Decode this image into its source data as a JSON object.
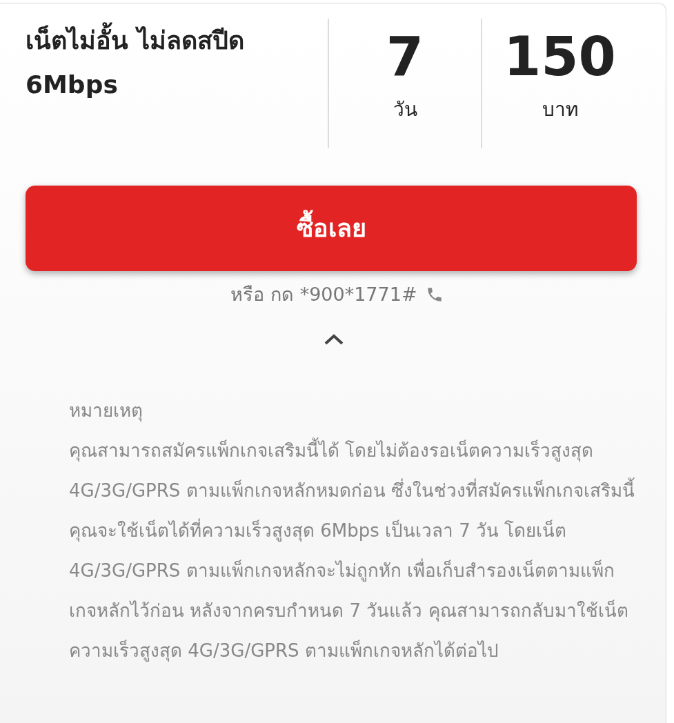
{
  "package": {
    "title": "เน็ตไม่อั้น ไม่ลดสปีด 6Mbps",
    "stats": [
      {
        "value": "7",
        "unit": "วัน"
      },
      {
        "value": "150",
        "unit": "บาท"
      }
    ]
  },
  "buy_button": "ซื้อเลย",
  "dial_hint": "หรือ กด *900*1771#",
  "expanded": true,
  "note": {
    "heading": "หมายเหตุ",
    "body": "คุณสามารถสมัครแพ็กเกจเสริมนี้ได้ โดยไม่ต้องรอเน็ตความเร็วสูงสุด 4G/3G/GPRS ตามแพ็กเกจหลักหมดก่อน ซึ่งในช่วงที่สมัครแพ็กเกจเสริมนี้ คุณจะใช้เน็ตได้ที่ความเร็วสูงสุด 6Mbps เป็นเวลา 7 วัน โดยเน็ต 4G/3G/GPRS ตามแพ็กเกจหลักจะไม่ถูกหัก เพื่อเก็บสำรองเน็ตตามแพ็กเกจหลักไว้ก่อน หลังจากครบกำหนด 7 วันแล้ว คุณสามารถกลับมาใช้เน็ตความเร็วสูงสุด 4G/3G/GPRS ตามแพ็กเกจหลักได้ต่อไป"
  }
}
